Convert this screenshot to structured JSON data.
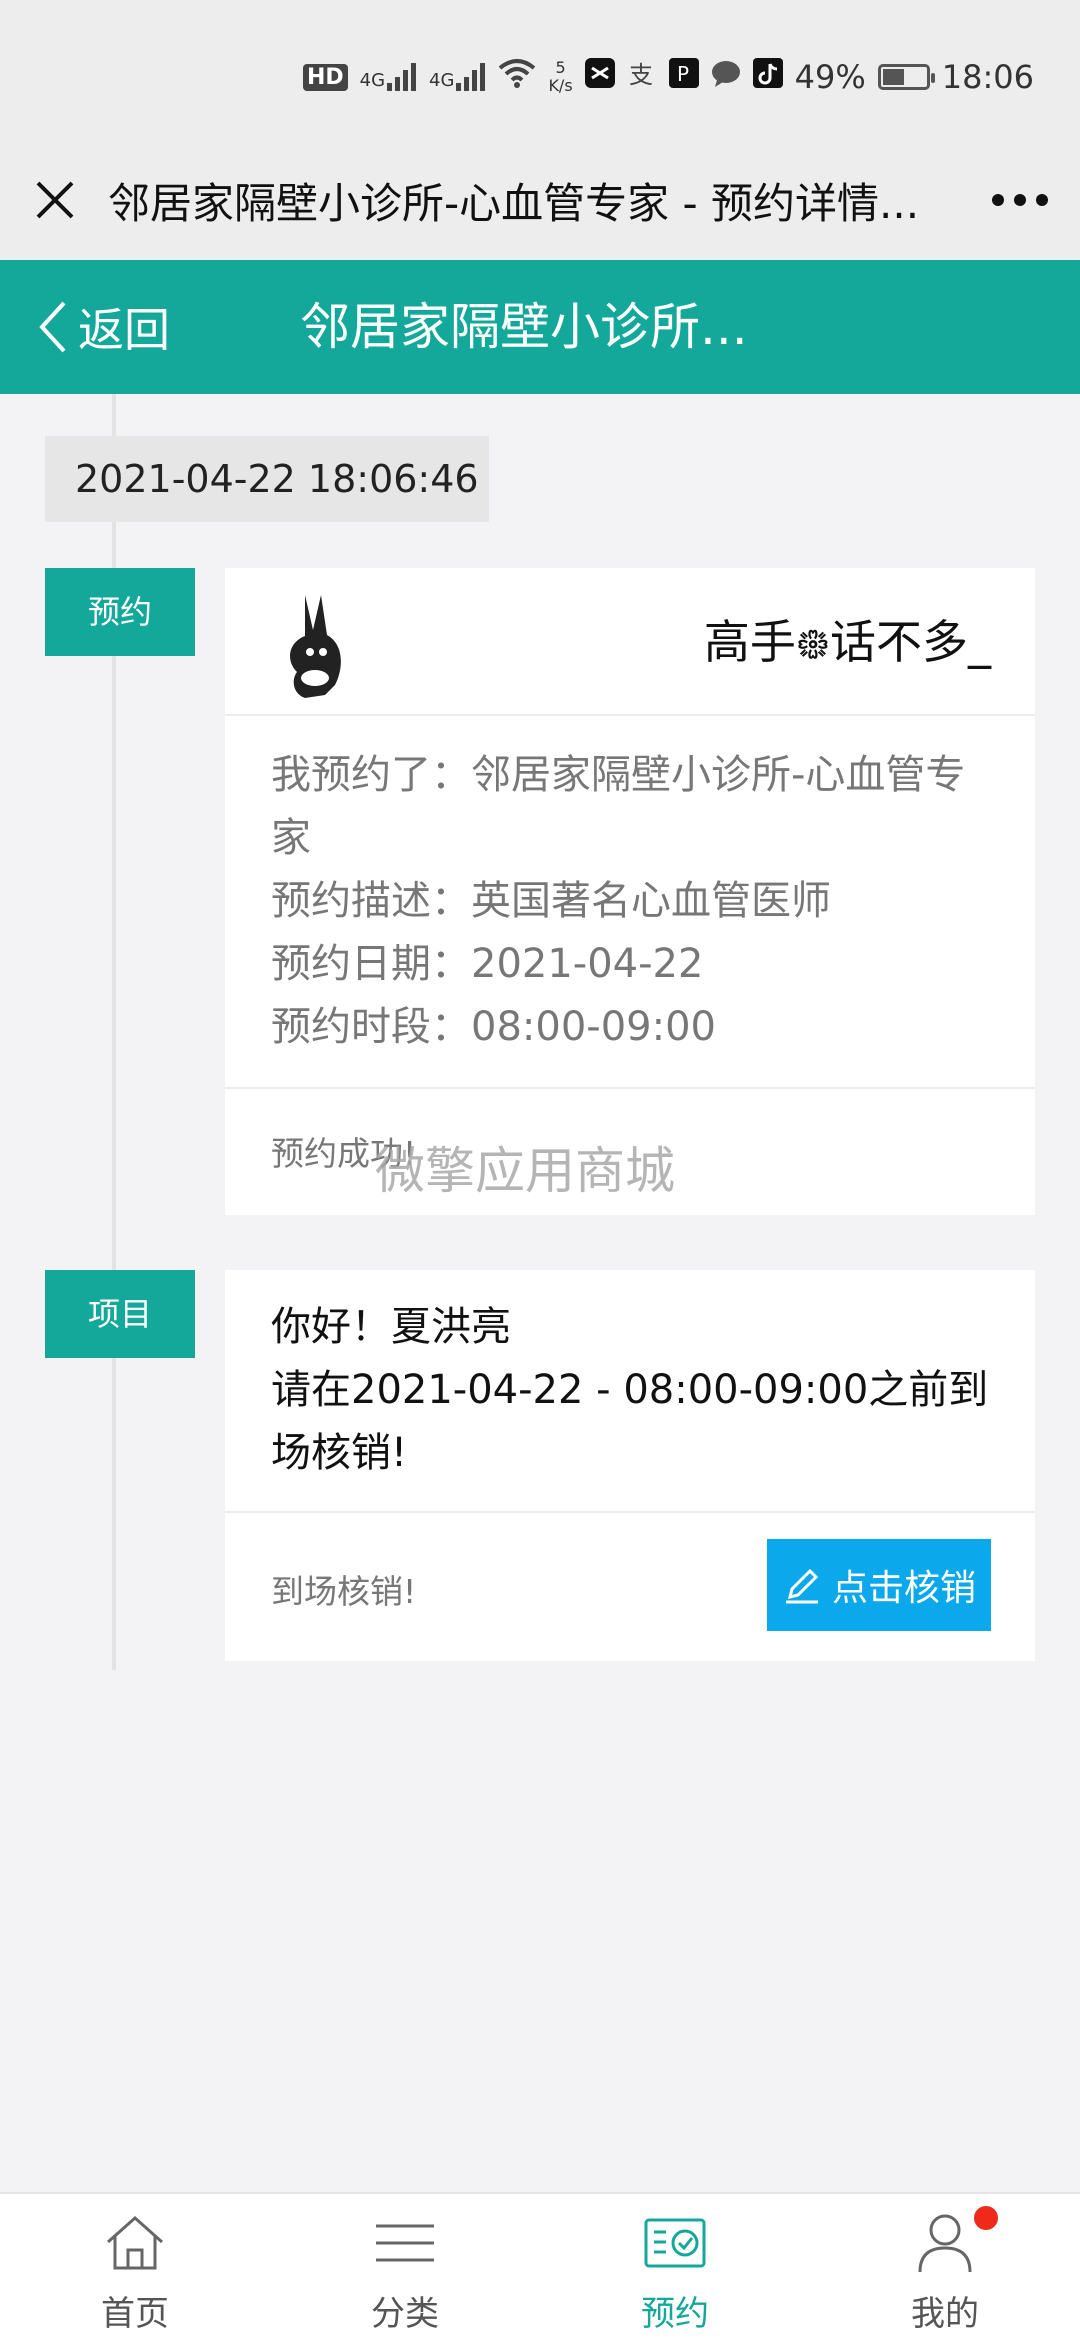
{
  "status_bar": {
    "hd_label": "HD",
    "signal1": "4G",
    "signal2": "4G",
    "net_speed_value": "5",
    "net_speed_unit": "K/s",
    "battery_percent": "49%",
    "battery_level": 0.49,
    "time": "18:06"
  },
  "wechat_bar": {
    "title": "邻居家隔壁小诊所-心血管专家 - 预约详情..."
  },
  "header": {
    "back_label": "返回",
    "title": "邻居家隔壁小诊所..."
  },
  "timeline": {
    "datetime": "2021-04-22 18:06:46",
    "sections": [
      {
        "tag": "预约",
        "nickname": "高手᪥话不多_",
        "lines": [
          "我预约了：邻居家隔壁小诊所-心血管专家",
          "预约描述：英国著名心血管医师",
          "预约日期：2021-04-22",
          "预约时段：08:00-09:00"
        ],
        "footer": "预约成功!",
        "watermark": "微擎应用商城"
      },
      {
        "tag": "项目",
        "lines": [
          "你好！夏洪亮",
          "请在2021-04-22 - 08:00-09:00之前到场核销!"
        ],
        "footer": "到场核销!",
        "button_label": "点击核销"
      }
    ]
  },
  "bottom_nav": {
    "items": [
      {
        "label": "首页",
        "icon": "home-icon"
      },
      {
        "label": "分类",
        "icon": "menu-icon"
      },
      {
        "label": "预约",
        "icon": "appointment-icon"
      },
      {
        "label": "我的",
        "icon": "user-icon"
      }
    ],
    "active_index": 2
  },
  "colors": {
    "primary": "#14a89a",
    "button": "#0ba8ec",
    "badge": "#f02a1a"
  }
}
